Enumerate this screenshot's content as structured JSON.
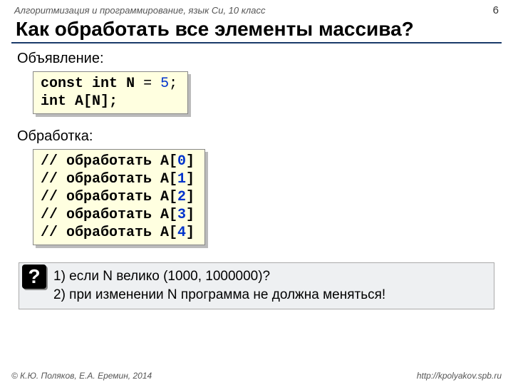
{
  "header": {
    "course": "Алгоритмизация и программирование, язык Си, 10 класс",
    "page": "6"
  },
  "title": "Как обработать все элементы массива?",
  "sections": {
    "declaration_label": "Объявление:",
    "processing_label": "Обработка:"
  },
  "code": {
    "kw_const": "const",
    "kw_int1": "int",
    "decl_n": "N",
    "decl_eq": " = ",
    "decl_val": "5",
    "decl_semi": ";",
    "kw_int2": "int",
    "decl_arr": " A[N];",
    "cmt_prefix": "// обработать A[",
    "cmt_suffix": "]",
    "idx0": "0",
    "idx1": "1",
    "idx2": "2",
    "idx3": "3",
    "idx4": "4"
  },
  "question": {
    "mark": "?",
    "line1": "1) если N велико (1000, 1000000)?",
    "line2": "2) при изменении N программа не должна меняться!"
  },
  "footer": {
    "authors": "© К.Ю. Поляков, Е.А. Еремин, 2014",
    "link": "http://kpolyakov.spb.ru"
  }
}
